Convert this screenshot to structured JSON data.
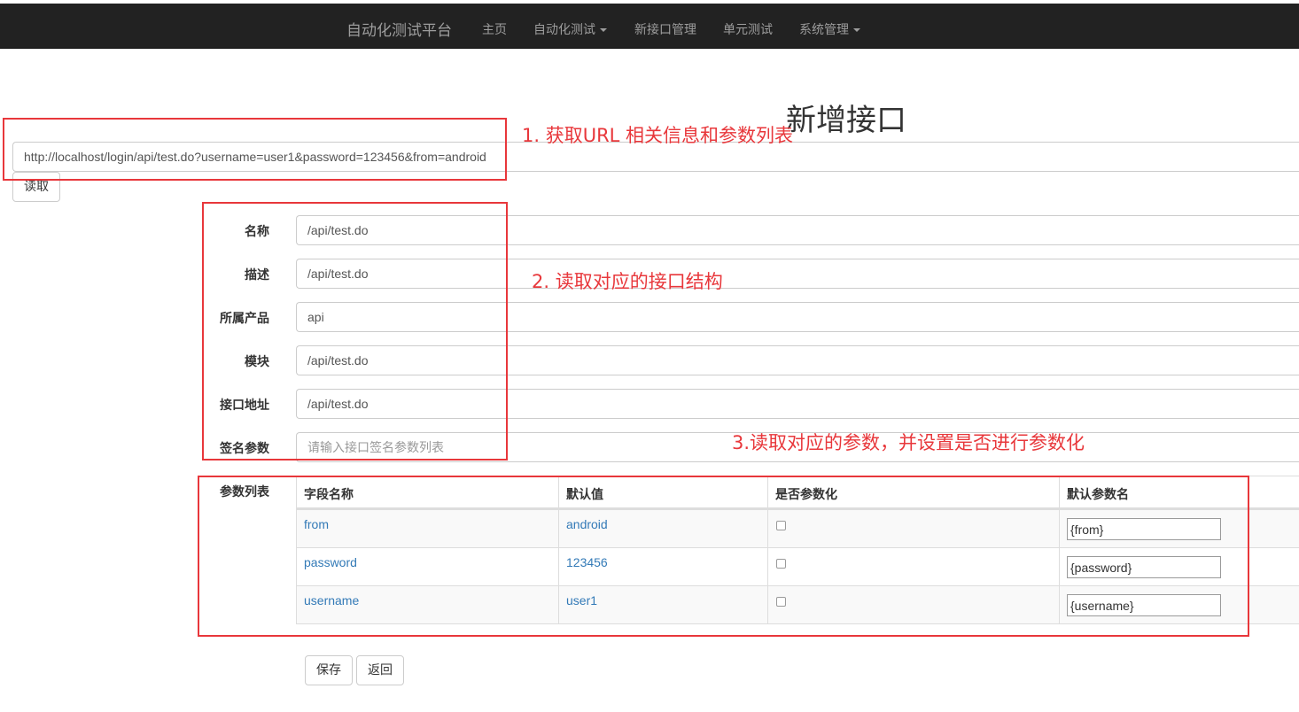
{
  "nav": {
    "brand": "自动化测试平台",
    "items": [
      {
        "label": "主页"
      },
      {
        "label": "自动化测试"
      },
      {
        "label": "新接口管理"
      },
      {
        "label": "单元测试"
      },
      {
        "label": "系统管理"
      }
    ]
  },
  "page_title": "新增接口",
  "url_input": {
    "value": "http://localhost/login/api/test.do?username=user1&password=123456&from=android"
  },
  "read_button": "读取",
  "annotations": {
    "step1": "1. 获取URL 相关信息和参数列表",
    "step2": "2. 读取对应的接口结构",
    "step3": "3.读取对应的参数，并设置是否进行参数化"
  },
  "form": {
    "name": {
      "label": "名称",
      "value": "/api/test.do"
    },
    "desc": {
      "label": "描述",
      "value": "/api/test.do"
    },
    "product": {
      "label": "所属产品",
      "value": "api"
    },
    "module": {
      "label": "模块",
      "value": "/api/test.do"
    },
    "address": {
      "label": "接口地址",
      "value": "/api/test.do"
    },
    "sign": {
      "label": "签名参数",
      "value": "",
      "placeholder": "请输入接口签名参数列表"
    }
  },
  "params": {
    "label": "参数列表",
    "headers": [
      "字段名称",
      "默认值",
      "是否参数化",
      "默认参数名"
    ],
    "rows": [
      {
        "field": "from",
        "default": "android",
        "parameterized": false,
        "param_name": "{from}"
      },
      {
        "field": "password",
        "default": "123456",
        "parameterized": false,
        "param_name": "{password}"
      },
      {
        "field": "username",
        "default": "user1",
        "parameterized": false,
        "param_name": "{username}"
      }
    ]
  },
  "buttons": {
    "save": "保存",
    "back": "返回"
  },
  "colors": {
    "navbar": "#222222",
    "nav_text": "#9d9d9d",
    "annotation": "#e8373b",
    "link": "#337ab7"
  },
  "icons": {
    "dropdown": "caret-down-icon"
  }
}
